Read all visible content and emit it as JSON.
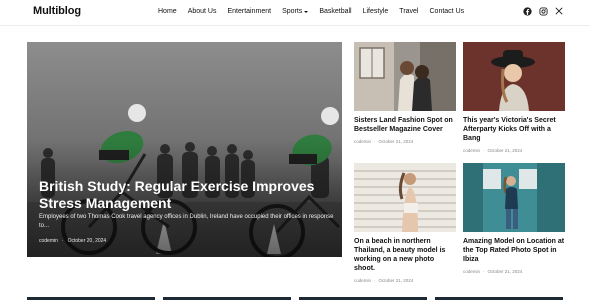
{
  "site": {
    "logo": "Multiblog"
  },
  "nav": [
    "Home",
    "About Us",
    "Entertainment",
    "Sports",
    "Basketball",
    "Lifestyle",
    "Travel",
    "Contact Us"
  ],
  "social_icons": [
    "facebook-icon",
    "instagram-icon",
    "x-icon"
  ],
  "hero": {
    "title": "British Study: Regular Exercise Improves Stress Management",
    "excerpt": "Employees of two Thomas Cook travel agency offices in Dublin, Ireland have occupied their offices in response to...",
    "author": "codemin",
    "date": "October 20, 2024"
  },
  "cards": [
    {
      "title": "Sisters Land Fashion Spot on Bestseller Magazine Cover",
      "author": "codemin",
      "date": "October 21, 2024"
    },
    {
      "title": "This year's Victoria's Secret Afterparty Kicks Off with a Bang",
      "author": "codemin",
      "date": "October 21, 2024"
    },
    {
      "title": "On a beach in northern Thailand, a beauty model is working on a new photo shoot.",
      "author": "codemin",
      "date": "October 21, 2024"
    },
    {
      "title": "Amazing Model on Location at the Top Rated Photo Spot in Ibiza",
      "author": "codemin",
      "date": "October 21, 2024"
    }
  ],
  "colors": {
    "accent": "#111111",
    "bottom_bar": "#1d2a36",
    "meta": "#888888"
  }
}
